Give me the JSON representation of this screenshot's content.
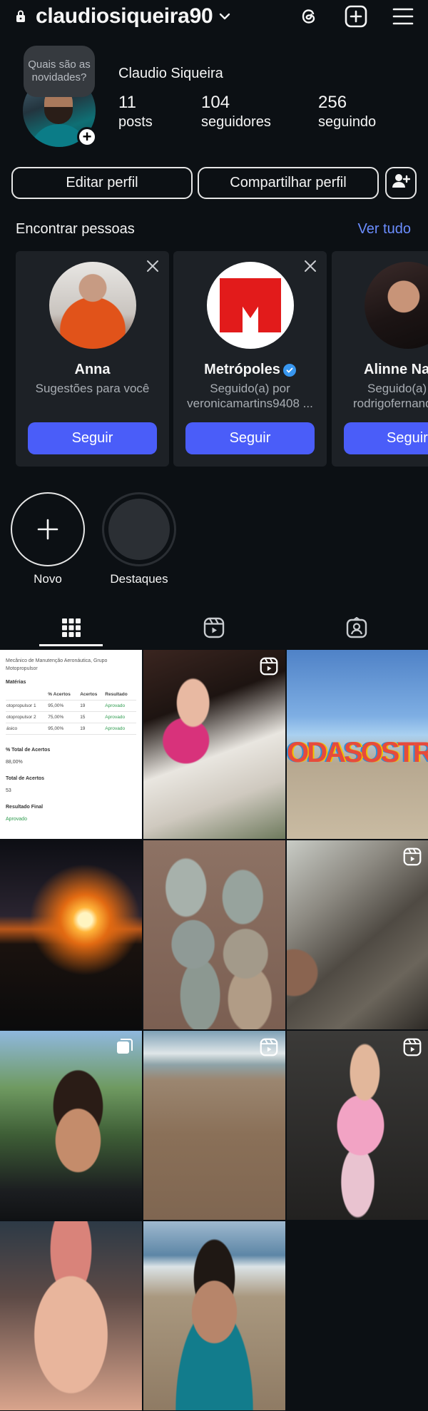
{
  "header": {
    "username": "claudiosiqueira90"
  },
  "profile": {
    "note": "Quais são as novidades?",
    "full_name": "Claudio Siqueira",
    "stats": [
      {
        "count": "11",
        "label": "posts"
      },
      {
        "count": "104",
        "label": "seguidores"
      },
      {
        "count": "256",
        "label": "seguindo"
      }
    ]
  },
  "actions": {
    "edit": "Editar perfil",
    "share": "Compartilhar perfil"
  },
  "suggestions": {
    "title": "Encontrar pessoas",
    "see_all": "Ver tudo",
    "cards": [
      {
        "name": "Anna",
        "sub": "Sugestões para você",
        "sub2": "",
        "button": "Seguir"
      },
      {
        "name": "Metrópoles",
        "sub": "Seguido(a) por",
        "sub2": "veronicamartins9408 ...",
        "button": "Seguir",
        "verified": true
      },
      {
        "name": "Alinne Nay",
        "sub": "Seguido(a)",
        "sub2": "rodrigofernand",
        "button": "Seguir"
      }
    ]
  },
  "highlights": [
    {
      "label": "Novo"
    },
    {
      "label": "Destaques"
    }
  ],
  "tabs": [
    "posts-grid",
    "reels",
    "tagged"
  ],
  "colors": {
    "background": "#0c1014",
    "accent": "#4a5df9",
    "link": "#6b8dff",
    "card": "#1d2126"
  },
  "posts": {
    "doc": {
      "heading": "Mecânico de Manutenção Aeronáutica, Grupo Motopropulsor",
      "materias": "Matérias",
      "cols": [
        "",
        "% Acertos",
        "Acertos",
        "Resultado"
      ],
      "rows": [
        [
          "otopropulsor 1",
          "95,00%",
          "19",
          "Aprovado"
        ],
        [
          "otopropulsor 2",
          "75,00%",
          "15",
          "Aprovado"
        ],
        [
          "ásico",
          "95,00%",
          "19",
          "Aprovado"
        ]
      ],
      "total_pct_label": "% Total de Acertos",
      "total_pct": "88,00%",
      "total_label": "Total de Acertos",
      "total": "53",
      "result_label": "Resultado Final",
      "result": "Aprovado"
    },
    "beach_sign": "ODASOSTRAS"
  }
}
